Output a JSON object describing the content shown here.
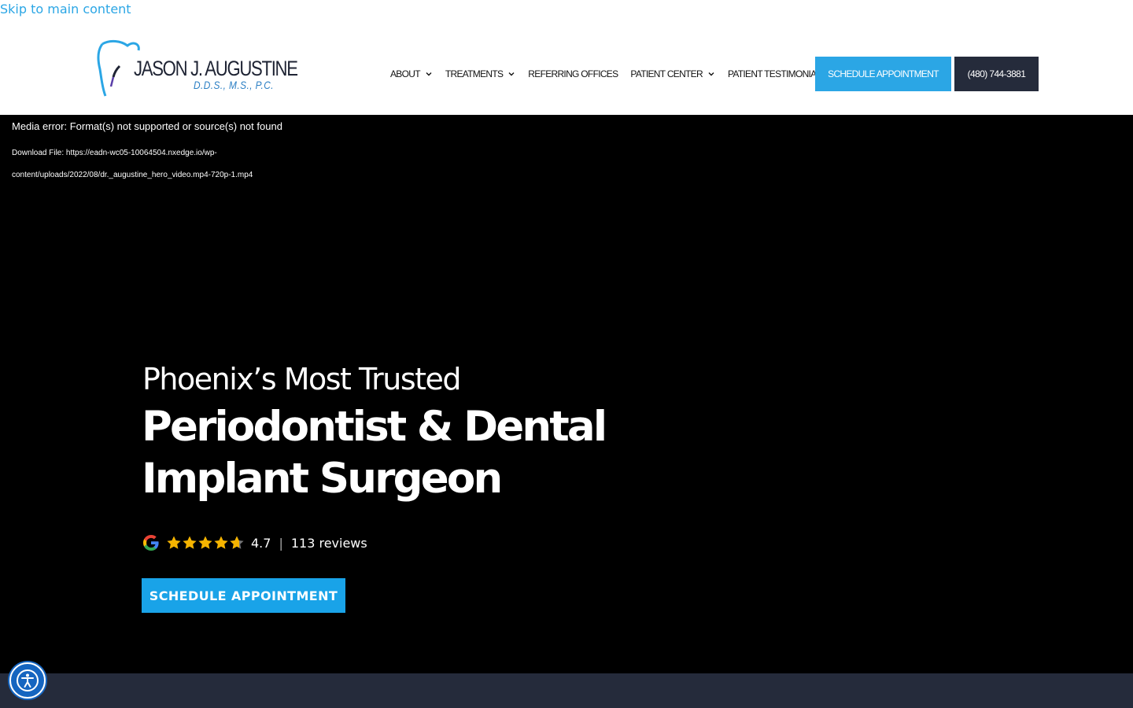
{
  "skip_link": "Skip to main content",
  "logo": {
    "name": "JASON J. AUGUSTINE",
    "credentials": "D.D.S., M.S., P.C.",
    "icon": "tooth-logo-icon"
  },
  "nav": {
    "items": [
      {
        "label": "ABOUT",
        "has_dropdown": true
      },
      {
        "label": "TREATMENTS",
        "has_dropdown": true
      },
      {
        "label": "REFERRING OFFICES",
        "has_dropdown": false
      },
      {
        "label": "PATIENT CENTER",
        "has_dropdown": true
      },
      {
        "label": "PATIENT TESTIMONIALS",
        "has_dropdown": false
      }
    ],
    "schedule_label": "SCHEDULE APPOINTMENT",
    "phone_label": "(480) 744-3881"
  },
  "media": {
    "error": "Media error: Format(s) not supported or source(s) not found",
    "download": "Download File: https://eadn-wc05-10064504.nxedge.io/wp-content/uploads/2022/08/dr._augustine_hero_video.mp4-720p-1.mp4"
  },
  "hero": {
    "subtitle": "Phoenix’s Most Trusted",
    "title": "Periodontist & Dental Implant Surgeon",
    "rating_value": "4.7",
    "rating_max": 5,
    "rating_sep": "|",
    "reviews": "113 reviews",
    "cta_label": "SCHEDULE APPOINTMENT"
  },
  "colors": {
    "accent": "#2ba6e5",
    "dark": "#252b3b",
    "star": "#f5b400"
  }
}
